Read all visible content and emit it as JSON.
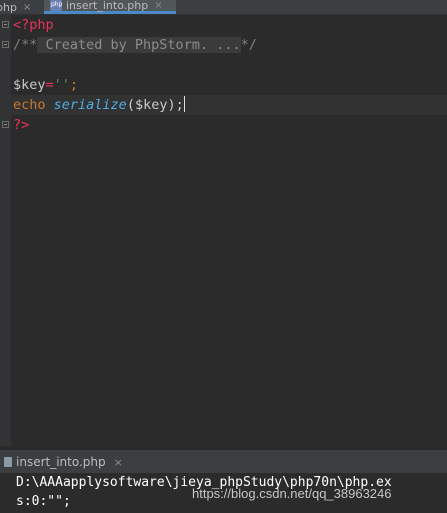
{
  "tabs": [
    {
      "label": "php",
      "close": "×"
    },
    {
      "label": "insert_into.php",
      "close": "×",
      "icon": "php-file-icon",
      "active": true
    }
  ],
  "code": {
    "line1": "<?php",
    "line2_open": "/**",
    "line2_folded": " Created by PhpStorm. ...",
    "line2_close": "*/",
    "line4_var": "$key",
    "line4_eq": "=",
    "line4_str": "''",
    "line4_semi": ";",
    "line5_kw": "echo",
    "line5_fn": "serialize",
    "line5_args": "($key);",
    "line6": "?>"
  },
  "run_panel": {
    "tab_label": "insert_into.php",
    "tab_close": "×",
    "output": [
      "D:\\AAAapplysoftware\\jieya_phpStudy\\php70n\\php.ex",
      "s:0:\"\";"
    ]
  },
  "watermark": "https://blog.csdn.net/qq_38963246",
  "colors": {
    "background": "#2b2b2b",
    "keyword": "#cc7832",
    "php_tag": "#e8345a",
    "function": "#4eade5",
    "string": "#6a8759",
    "comment": "#808080",
    "active_tab_underline": "#4a88c7"
  }
}
